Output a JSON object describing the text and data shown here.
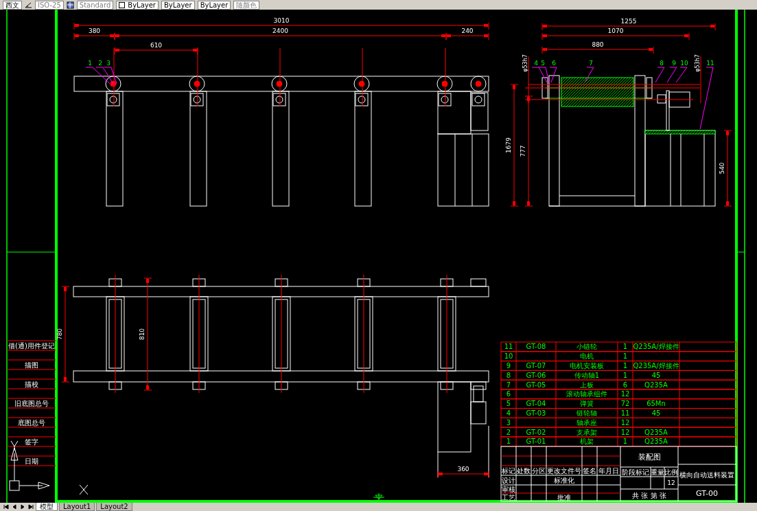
{
  "toolbar": {
    "text_style": "西文",
    "dim_style": "ISO-25",
    "table_style": "Standard",
    "color_setting": "ByLayer",
    "linetype": "ByLayer",
    "lineweight": "ByLayer",
    "plot_style": "随颜色"
  },
  "front_view": {
    "dims": [
      "3010",
      "380",
      "2400",
      "240",
      "610"
    ],
    "balloons": [
      "1",
      "2",
      "3"
    ]
  },
  "side_view": {
    "dims": [
      "1255",
      "1070",
      "880"
    ],
    "fits": [
      "φ53h7",
      "φ53h7"
    ],
    "vdims": [
      "1679",
      "777",
      "540"
    ],
    "balloons": [
      "4",
      "5",
      "6",
      "7",
      "8",
      "9",
      "10",
      "11"
    ]
  },
  "top_view": {
    "dims": [
      "780",
      "810",
      "360"
    ]
  },
  "side_labels": [
    "借(通)用件登记",
    "描图",
    "描校",
    "旧底图总号",
    "底图总号",
    "签字",
    "日期"
  ],
  "bom": [
    {
      "no": "11",
      "code": "GT-08",
      "name": "小链轮",
      "qty": "1",
      "material": "Q235A/焊接件"
    },
    {
      "no": "10",
      "name": "电机",
      "qty": "1"
    },
    {
      "no": "9",
      "code": "GT-07",
      "name": "电机安装板",
      "qty": "1",
      "material": "Q235A/焊接件"
    },
    {
      "no": "8",
      "code": "GT-06",
      "name": "传动轴1",
      "qty": "1",
      "material": "45"
    },
    {
      "no": "7",
      "code": "GT-05",
      "name": "上板",
      "qty": "6",
      "material": "Q235A"
    },
    {
      "no": "6",
      "name": "滚动轴承组件",
      "qty": "12"
    },
    {
      "no": "5",
      "code": "GT-04",
      "name": "弹簧",
      "qty": "72",
      "material": "65Mn"
    },
    {
      "no": "4",
      "code": "GT-03",
      "name": "链轮轴",
      "qty": "11",
      "material": "45"
    },
    {
      "no": "3",
      "name": "轴承座",
      "qty": "12"
    },
    {
      "no": "2",
      "code": "GT-02",
      "name": "支承架",
      "qty": "12",
      "material": "Q235A"
    },
    {
      "no": "1",
      "code": "GT-01",
      "name": "机架",
      "qty": "1",
      "material": "Q235A"
    }
  ],
  "title_block": {
    "header": [
      "标记",
      "处数",
      "分区",
      "更改文件号",
      "签名",
      "年月日"
    ],
    "design": "设计",
    "standardization": "标准化",
    "review": "审核",
    "process": "工艺",
    "approval": "批准",
    "drawing_type": "装配图",
    "stage": "阶段标记",
    "weight": "重量",
    "scale": "比例",
    "scale_value": "12",
    "sheets": "共 张 第 张",
    "product_name": "横向自动送料装置",
    "drawing_no": "GT-00"
  },
  "layout_tabs": [
    {
      "label": "模型",
      "selected": true
    },
    {
      "label": "Layout1",
      "selected": false
    },
    {
      "label": "Layout2",
      "selected": false
    }
  ]
}
